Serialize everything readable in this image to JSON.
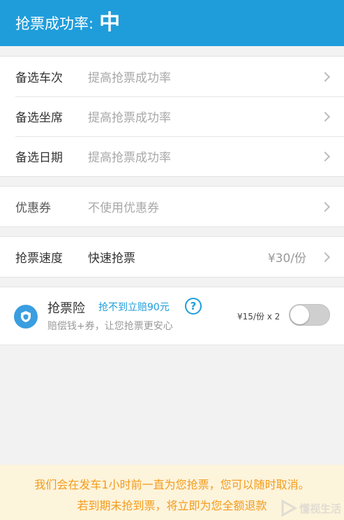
{
  "header": {
    "label": "抢票成功率:",
    "value": "中"
  },
  "options_group": [
    {
      "label": "备选车次",
      "value": "提高抢票成功率"
    },
    {
      "label": "备选坐席",
      "value": "提高抢票成功率"
    },
    {
      "label": "备选日期",
      "value": "提高抢票成功率"
    }
  ],
  "coupon": {
    "label": "优惠券",
    "value": "不使用优惠券"
  },
  "speed": {
    "label": "抢票速度",
    "value": "快速抢票",
    "price": "¥30/份"
  },
  "insurance": {
    "title": "抢票险",
    "tag": "抢不到立赔90元",
    "help": "?",
    "subtitle": "赔偿钱+券，让您抢票更安心",
    "price": "¥15/份 x 2",
    "enabled": false
  },
  "notice": {
    "line1": "我们会在发车1小时前一直为您抢票，您可以随时取消。",
    "line2": "若到期未抢到票，将立即为您全额退款"
  },
  "watermark": {
    "text": "懂视生活"
  },
  "colors": {
    "primary": "#1f9ddb",
    "notice_text": "#f39b1b",
    "notice_bg": "#fdf4dc"
  },
  "icons": [
    "shield-icon",
    "chevron-right-icon",
    "help-icon"
  ]
}
